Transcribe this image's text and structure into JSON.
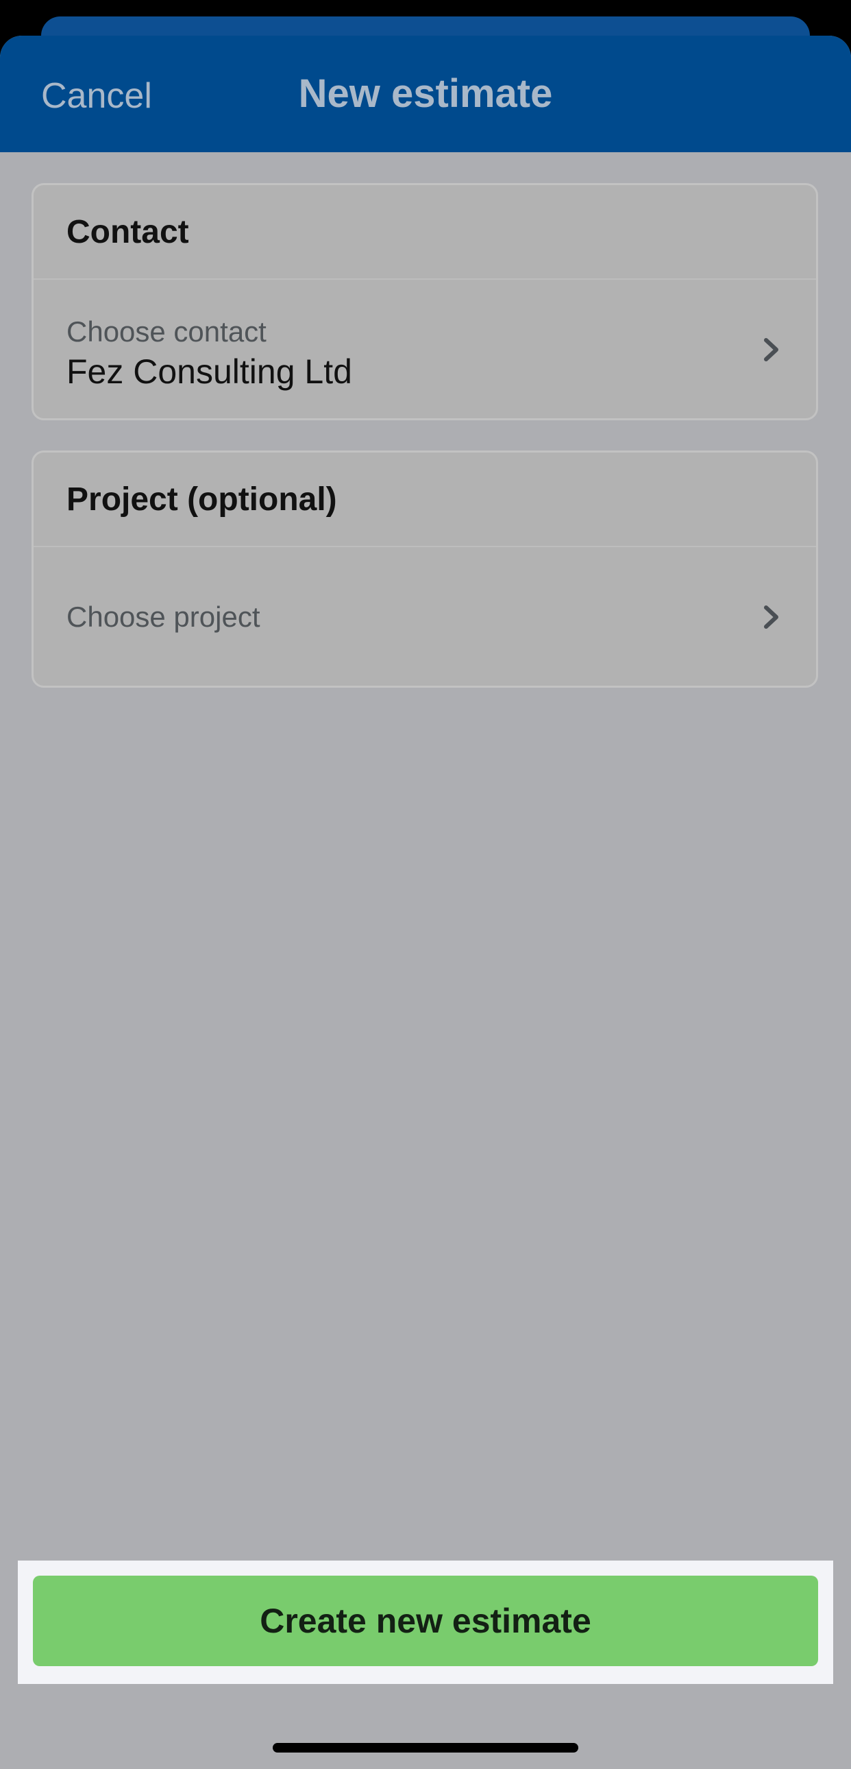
{
  "nav": {
    "cancel_label": "Cancel",
    "title": "New estimate"
  },
  "contact_card": {
    "header": "Contact",
    "row_label": "Choose contact",
    "row_value": "Fez Consulting Ltd"
  },
  "project_card": {
    "header": "Project (optional)",
    "row_label": "Choose project"
  },
  "cta": {
    "label": "Create new estimate"
  },
  "icons": {
    "row_chevron": "chevron-right-icon"
  },
  "colors": {
    "nav_background": "#004a8d",
    "overlay_background": "#adaeb2",
    "cta_background": "#79cc6d"
  }
}
